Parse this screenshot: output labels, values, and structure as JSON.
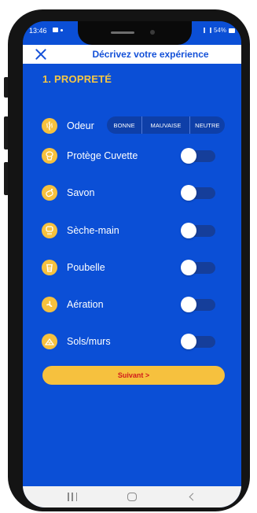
{
  "status_bar": {
    "time": "13:46",
    "battery": "54%"
  },
  "header": {
    "title": "Décrivez votre expérience"
  },
  "section": {
    "title": "1. PROPRETÉ"
  },
  "odeur": {
    "label": "Odeur",
    "options": [
      "BONNE",
      "MAUVAISE",
      "NEUTRE"
    ]
  },
  "items": [
    {
      "label": "Protège Cuvette",
      "icon": "toilet-seat-icon",
      "enabled": false
    },
    {
      "label": "Savon",
      "icon": "soap-icon",
      "enabled": false
    },
    {
      "label": "Sèche-main",
      "icon": "hand-dryer-icon",
      "enabled": false
    },
    {
      "label": "Poubelle",
      "icon": "trash-bin-icon",
      "enabled": false
    },
    {
      "label": "Aération",
      "icon": "fan-icon",
      "enabled": false
    },
    {
      "label": "Sols/murs",
      "icon": "floor-icon",
      "enabled": false
    }
  ],
  "next_button": {
    "label": "Suivant >"
  },
  "colors": {
    "background": "#0b4fd6",
    "accent": "#f6c13e",
    "header_text": "#1451d8",
    "button_text": "#d11b1b",
    "toggle_track": "#153e9a"
  }
}
